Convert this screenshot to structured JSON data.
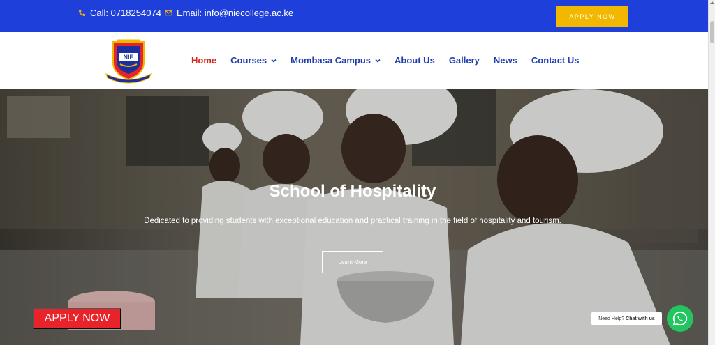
{
  "topbar": {
    "phone": "Call: 0718254074",
    "email": "Email: info@niecollege.ac.ke",
    "apply_label": "APPLY NOW"
  },
  "nav": {
    "items": [
      {
        "label": "Home",
        "active": true,
        "dropdown": false
      },
      {
        "label": "Courses",
        "active": false,
        "dropdown": true
      },
      {
        "label": "Mombasa Campus",
        "active": false,
        "dropdown": true
      },
      {
        "label": "About Us",
        "active": false,
        "dropdown": false
      },
      {
        "label": "Gallery",
        "active": false,
        "dropdown": false
      },
      {
        "label": "News",
        "active": false,
        "dropdown": false
      },
      {
        "label": "Contact Us",
        "active": false,
        "dropdown": false
      }
    ]
  },
  "logo": {
    "text": "NIE"
  },
  "hero": {
    "title": "School of Hospitality",
    "description": "Dedicated to providing students with exceptional education and practical training in the field of hospitality and tourism.",
    "button_label": "Learn More"
  },
  "floating": {
    "apply_label": "APPLY NOW",
    "help_text": "Need Help?",
    "chat_text": "Chat with us"
  },
  "colors": {
    "topbar": "#1f3fdb",
    "accent_yellow": "#f2b800",
    "nav_active": "#d0281e",
    "nav_text": "#1f3fb0",
    "apply_red": "#e8242a",
    "whatsapp": "#23c55e"
  }
}
